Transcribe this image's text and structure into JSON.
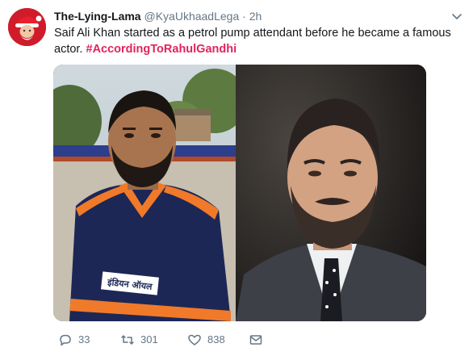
{
  "tweet": {
    "display_name": "The-Lying-Lama",
    "handle": "@KyaUkhaadLega",
    "separator": "·",
    "time": "2h",
    "text": "Saif Ali Khan started as a petrol pump attendant before he became a famous actor.",
    "hashtag": "#AccordingToRahulGandhi",
    "uniform_text": "इंडियन ऑयल"
  },
  "actions": {
    "replies": "33",
    "retweets": "301",
    "likes": "838"
  },
  "icons": {
    "avatar": "santa-avatar",
    "menu": "chevron-down-icon",
    "reply": "reply-icon",
    "retweet": "retweet-icon",
    "like": "heart-icon",
    "message": "envelope-icon"
  },
  "colors": {
    "text": "#14171a",
    "secondary": "#657786",
    "hashtag": "#e0245e"
  }
}
